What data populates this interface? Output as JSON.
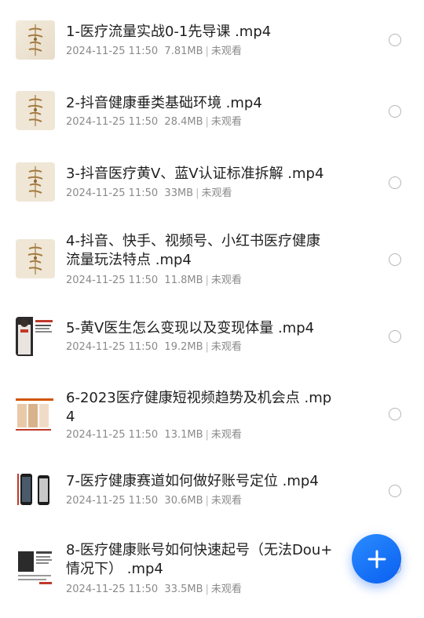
{
  "files": [
    {
      "title": "1-医疗流量实战0-1先导课 .mp4",
      "date": "2024-11-25 11:50",
      "size": "7.81MB",
      "status": "未观看",
      "thumb": "calligraphy-thumbnail"
    },
    {
      "title": "2-抖音健康垂类基础环境 .mp4",
      "date": "2024-11-25 11:50",
      "size": "28.4MB",
      "status": "未观看",
      "thumb": "calligraphy-thumbnail"
    },
    {
      "title": "3-抖音医疗黄V、蓝V认证标准拆解 .mp4",
      "date": "2024-11-25 11:50",
      "size": "33MB",
      "status": "未观看",
      "thumb": "calligraphy-thumbnail"
    },
    {
      "title": "4-抖音、快手、视频号、小红书医疗健康\n流量玩法特点 .mp4",
      "date": "2024-11-25 11:50",
      "size": "11.8MB",
      "status": "未观看",
      "thumb": "calligraphy-thumbnail"
    },
    {
      "title": "5-黄V医生怎么变现以及变现体量 .mp4",
      "date": "2024-11-25 11:50",
      "size": "19.2MB",
      "status": "未观看",
      "thumb": "doctor-slide-thumbnail"
    },
    {
      "title": "6-2023医疗健康短视频趋势及机会点 .mp\n4",
      "date": "2024-11-25 11:50",
      "size": "13.1MB",
      "status": "未观看",
      "thumb": "slide-thumbnail"
    },
    {
      "title": "7-医疗健康赛道如何做好账号定位 .mp4",
      "date": "2024-11-25 11:50",
      "size": "30.6MB",
      "status": "未观看",
      "thumb": "phone-screens-thumbnail"
    },
    {
      "title": "8-医疗健康账号如何快速起号（无法Dou+\n情况下） .mp4",
      "date": "2024-11-25 11:50",
      "size": "33.5MB",
      "status": "未观看",
      "thumb": "document-thumbnail"
    }
  ],
  "fab": {
    "icon": "plus-icon"
  },
  "colors": {
    "accent": "#1677ff",
    "text": "#1f1f1f",
    "meta": "#8a8a8a"
  }
}
